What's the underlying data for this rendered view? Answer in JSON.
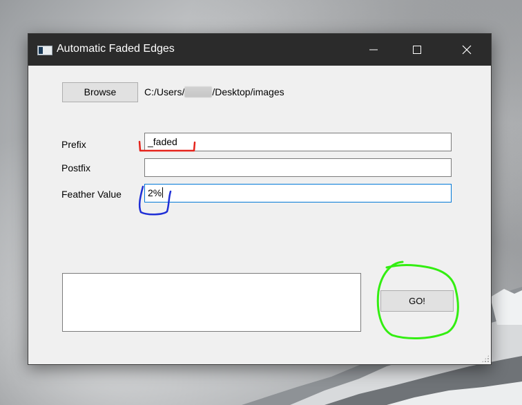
{
  "window": {
    "title": "Automatic Faded Edges"
  },
  "browse": {
    "button_label": "Browse",
    "path_prefix": "C:/Users/",
    "path_suffix": "/Desktop/images"
  },
  "form": {
    "prefix": {
      "label": "Prefix",
      "value": "_faded"
    },
    "postfix": {
      "label": "Postfix",
      "value": ""
    },
    "feather": {
      "label": "Feather Value",
      "value": "2%"
    }
  },
  "actions": {
    "go_label": "GO!"
  },
  "colors": {
    "titlebar": "#2b2b2b",
    "window_bg": "#f0f0f0",
    "focus_border": "#0078d7",
    "annotation_red": "#e5231b",
    "annotation_blue": "#1f2fd6",
    "annotation_green": "#33ee11"
  },
  "icons": {
    "app": "window-app-icon",
    "minimize": "minimize-icon",
    "maximize": "maximize-icon",
    "close": "close-icon",
    "resize": "resize-grip-icon"
  }
}
